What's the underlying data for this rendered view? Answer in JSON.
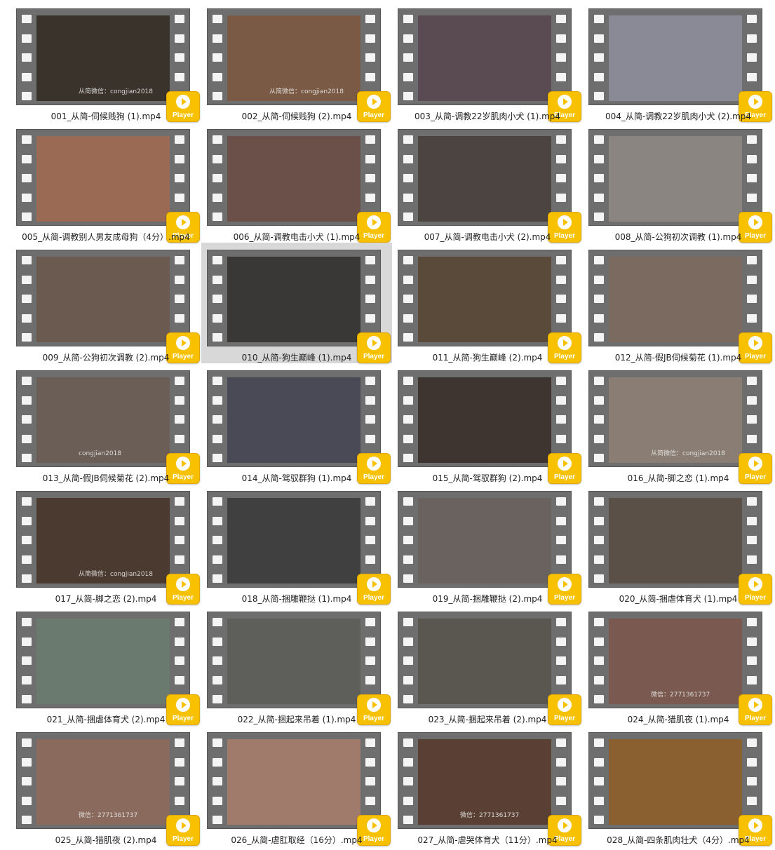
{
  "view": {
    "selected_index": 9,
    "player_label": "Player",
    "player_icon": "play-icon",
    "accent_color": "#f7c100"
  },
  "files": [
    {
      "name": "001_从简-伺候贱狗 (1).mp4",
      "watermark": "从简微信：congjian2018",
      "tone": "#3a332c"
    },
    {
      "name": "002_从简-伺候贱狗 (2).mp4",
      "watermark": "从简微信：congjian2018",
      "tone": "#7a5a44"
    },
    {
      "name": "003_从简-调教22岁肌肉小犬 (1).mp4",
      "watermark": "",
      "tone": "#5a4a52"
    },
    {
      "name": "004_从简-调教22岁肌肉小犬 (2).mp4",
      "watermark": "",
      "tone": "#8a8a96"
    },
    {
      "name": "005_从简-调教别人男友成母狗（4分）.mp4",
      "watermark": "",
      "tone": "#9a6a55"
    },
    {
      "name": "006_从简-调教电击小犬 (1).mp4",
      "watermark": "",
      "tone": "#6a5048"
    },
    {
      "name": "007_从简-调教电击小犬 (2).mp4",
      "watermark": "",
      "tone": "#4c4440"
    },
    {
      "name": "008_从简-公狗初次调教 (1).mp4",
      "watermark": "",
      "tone": "#8a8580"
    },
    {
      "name": "009_从简-公狗初次调教 (2).mp4",
      "watermark": "",
      "tone": "#6a5a50"
    },
    {
      "name": "010_从简-狗生巅峰 (1).mp4",
      "watermark": "",
      "tone": "#3a3836"
    },
    {
      "name": "011_从简-狗生巅峰 (2).mp4",
      "watermark": "",
      "tone": "#5a4a3a"
    },
    {
      "name": "012_从简-假JB伺候菊花 (1).mp4",
      "watermark": "",
      "tone": "#7a6a60"
    },
    {
      "name": "013_从简-假JB伺候菊花 (2).mp4",
      "watermark": "congjian2018",
      "tone": "#6a5e56"
    },
    {
      "name": "014_从简-驾驭群狗 (1).mp4",
      "watermark": "",
      "tone": "#4a4a56"
    },
    {
      "name": "015_从简-驾驭群狗 (2).mp4",
      "watermark": "",
      "tone": "#3e3430"
    },
    {
      "name": "016_从简-脚之恋 (1).mp4",
      "watermark": "从简微信：congjian2018",
      "tone": "#8a7e74"
    },
    {
      "name": "017_从简-脚之恋 (2).mp4",
      "watermark": "从简微信：congjian2018",
      "tone": "#4a3a30"
    },
    {
      "name": "018_从简-捆雕鞭挞 (1).mp4",
      "watermark": "",
      "tone": "#404040"
    },
    {
      "name": "019_从简-捆雕鞭挞 (2).mp4",
      "watermark": "",
      "tone": "#6a625e"
    },
    {
      "name": "020_从简-捆虐体育犬 (1).mp4",
      "watermark": "",
      "tone": "#5a5048"
    },
    {
      "name": "021_从简-捆虐体育犬 (2).mp4",
      "watermark": "",
      "tone": "#6a7a6e"
    },
    {
      "name": "022_从简-捆起来吊着 (1).mp4",
      "watermark": "",
      "tone": "#5e5e5a"
    },
    {
      "name": "023_从简-捆起来吊着 (2).mp4",
      "watermark": "",
      "tone": "#5a5650"
    },
    {
      "name": "024_从简-猎肌夜 (1).mp4",
      "watermark": "微信：2771361737",
      "tone": "#7a5a50"
    },
    {
      "name": "025_从简-猎肌夜 (2).mp4",
      "watermark": "微信：2771361737",
      "tone": "#8a6a5c"
    },
    {
      "name": "026_从简-虐肛取经（16分）.mp4",
      "watermark": "",
      "tone": "#a07a6a"
    },
    {
      "name": "027_从简-虐哭体育犬（11分）.mp4",
      "watermark": "微信：2771361737",
      "tone": "#5a4034"
    },
    {
      "name": "028_从简-四条肌肉壮犬（4分）.mp4",
      "watermark": "",
      "tone": "#8a6030"
    }
  ]
}
